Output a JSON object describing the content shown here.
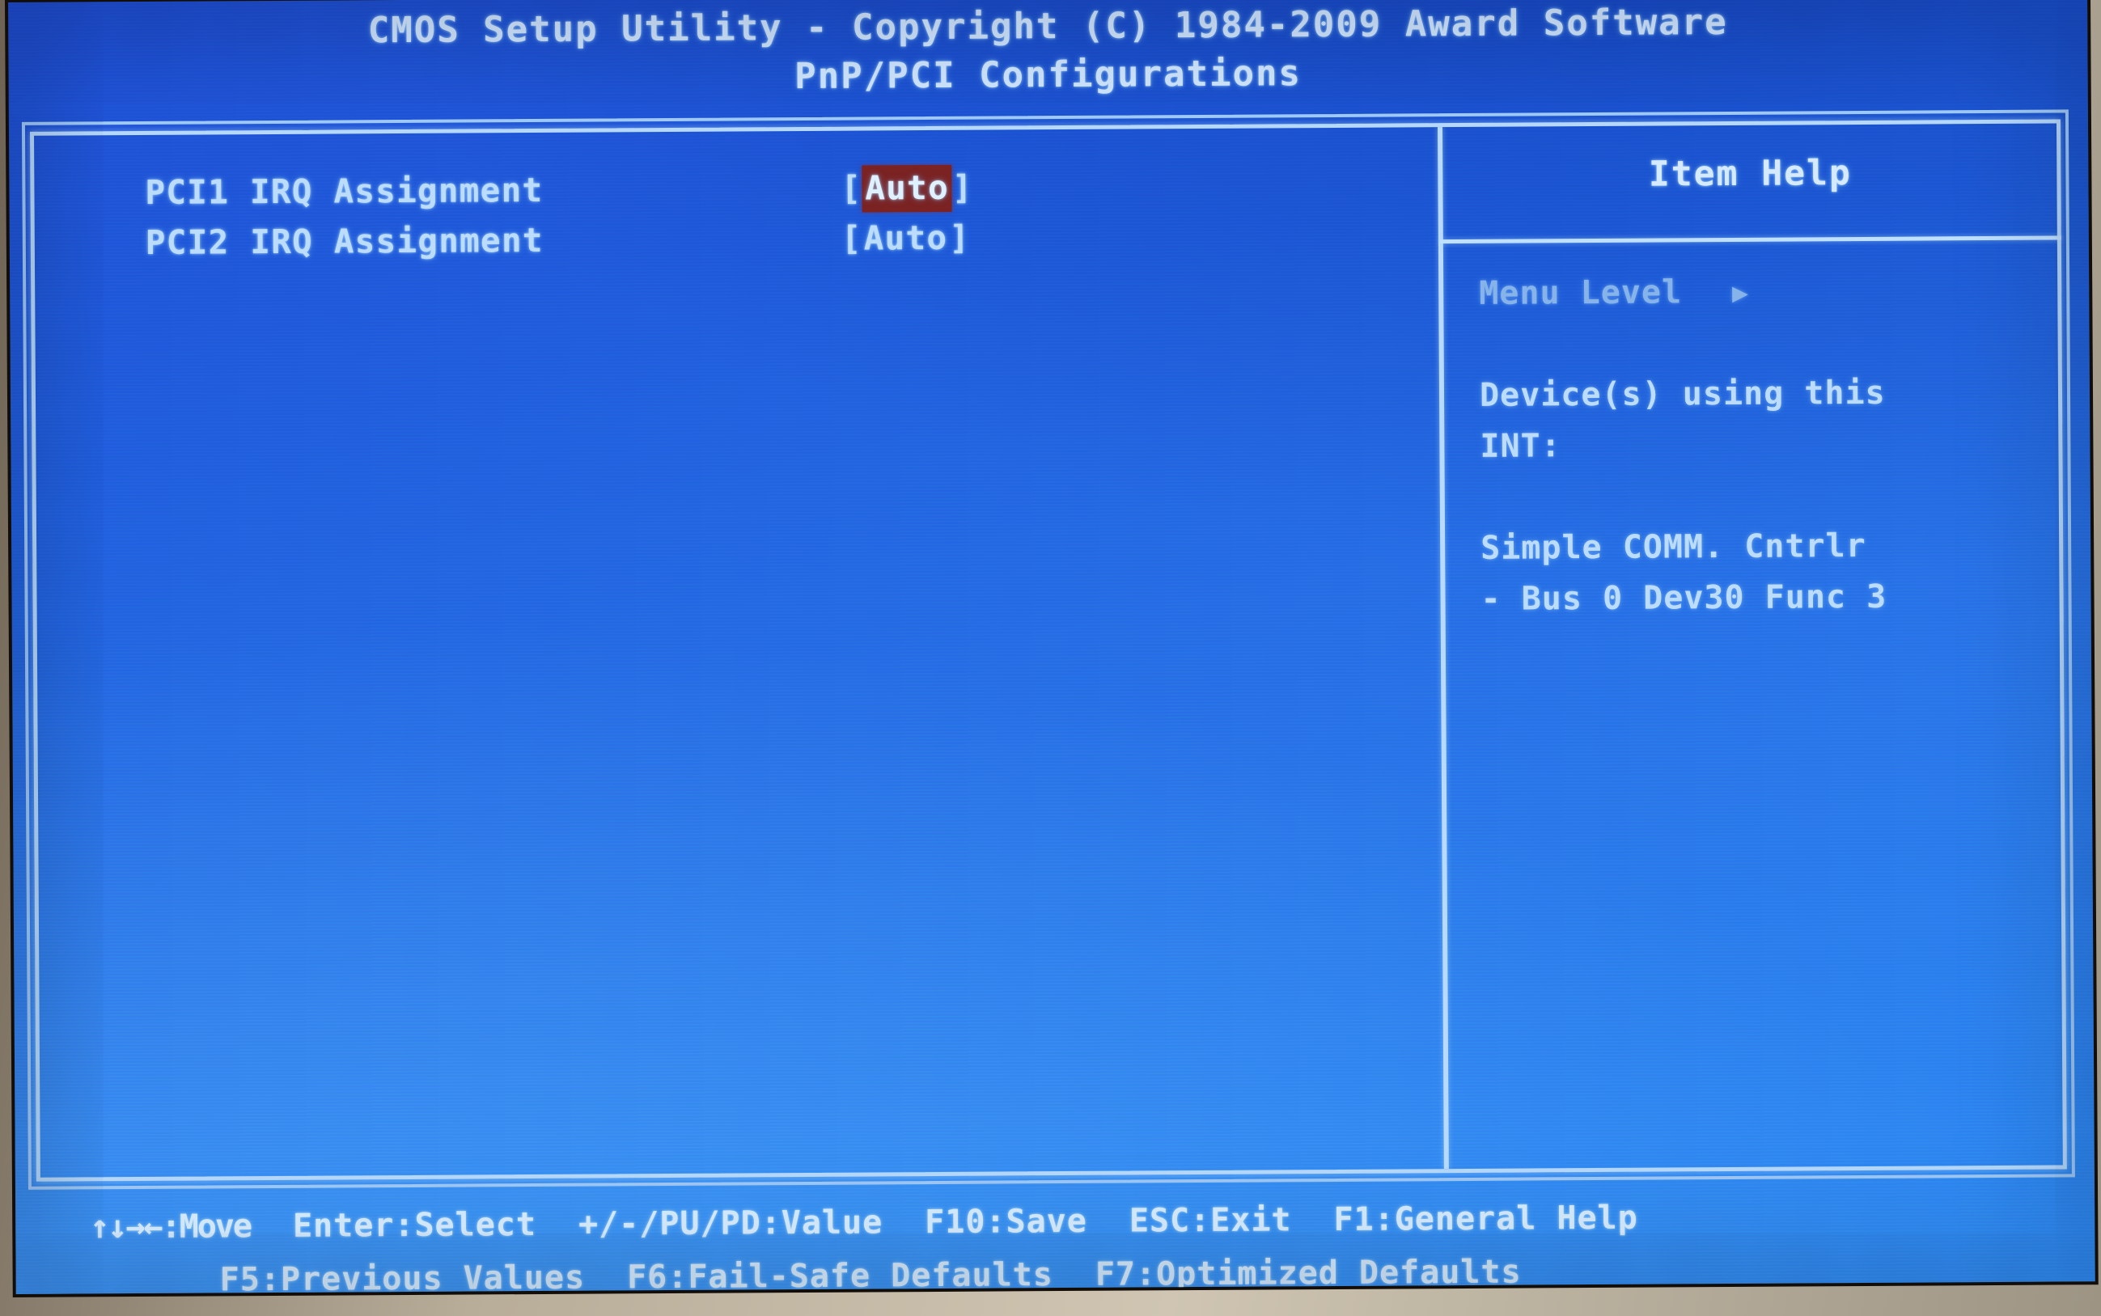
{
  "header": {
    "title": "CMOS Setup Utility - Copyright (C) 1984-2009 Award Software",
    "subtitle": "PnP/PCI Configurations"
  },
  "settings": [
    {
      "label": "PCI1 IRQ Assignment",
      "open_bracket": "[",
      "value": "Auto",
      "close_bracket": "]",
      "selected": true
    },
    {
      "label": "PCI2 IRQ Assignment",
      "open_bracket": "[",
      "value": "Auto",
      "close_bracket": "]",
      "selected": false
    }
  ],
  "help": {
    "title": "Item Help",
    "menu_level_label": "Menu Level",
    "menu_level_caret": "▶",
    "line1": "Device(s) using this",
    "line2": "INT:",
    "line3": "Simple COMM. Cntrlr",
    "line4": "- Bus 0 Dev30 Func 3"
  },
  "footer": {
    "row1": [
      {
        "name": "move",
        "text": "↑↓→←:Move"
      },
      {
        "name": "enter-select",
        "text": "Enter:Select"
      },
      {
        "name": "value",
        "text": "+/-/PU/PD:Value"
      },
      {
        "name": "f10-save",
        "text": "F10:Save"
      },
      {
        "name": "esc-exit",
        "text": "ESC:Exit"
      },
      {
        "name": "f1-general-help",
        "text": "F1:General Help"
      }
    ],
    "row2": [
      {
        "name": "f5-previous-values",
        "text": "F5:Previous Values"
      },
      {
        "name": "f6-fail-safe-defaults",
        "text": "F6:Fail-Safe Defaults"
      },
      {
        "name": "f7-optimized-defaults",
        "text": "F7:Optimized Defaults"
      }
    ]
  },
  "colors": {
    "screen_blue_top": "#1f4fd4",
    "screen_blue_bottom": "#2f8df4",
    "text_light": "#bcdcfb",
    "frame_line": "#b5d8fb",
    "selection_bg": "#7b2222",
    "bezel": "#cfc5b2"
  }
}
